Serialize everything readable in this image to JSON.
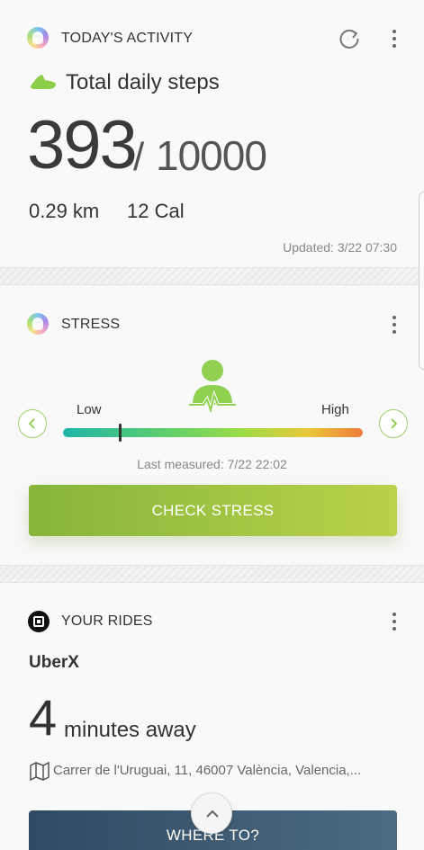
{
  "activity": {
    "title": "TODAY'S ACTIVITY",
    "metric_label": "Total daily steps",
    "steps": "393",
    "slash": "/",
    "goal": "10000",
    "distance": "0.29 km",
    "calories": "12 Cal",
    "updated": "Updated: 3/22 07:30"
  },
  "stress": {
    "title": "STRESS",
    "low_label": "Low",
    "high_label": "High",
    "level": 0.19,
    "last_measured": "Last measured: 7/22 22:02",
    "check_button": "CHECK STRESS",
    "colors": {
      "bar_start": "#1fb5a9",
      "bar_mid": "#8ed94a",
      "bar_end": "#f07a3a",
      "button_start": "#86b53a",
      "button_end": "#b9d24a",
      "figure": "#8fd14f"
    }
  },
  "rides": {
    "title": "YOUR RIDES",
    "product": "UberX",
    "eta_number": "4",
    "eta_text": "minutes away",
    "address": "Carrer de l'Uruguai, 11, 46007 València, Valencia,...",
    "where_button": "WHERE TO?"
  }
}
